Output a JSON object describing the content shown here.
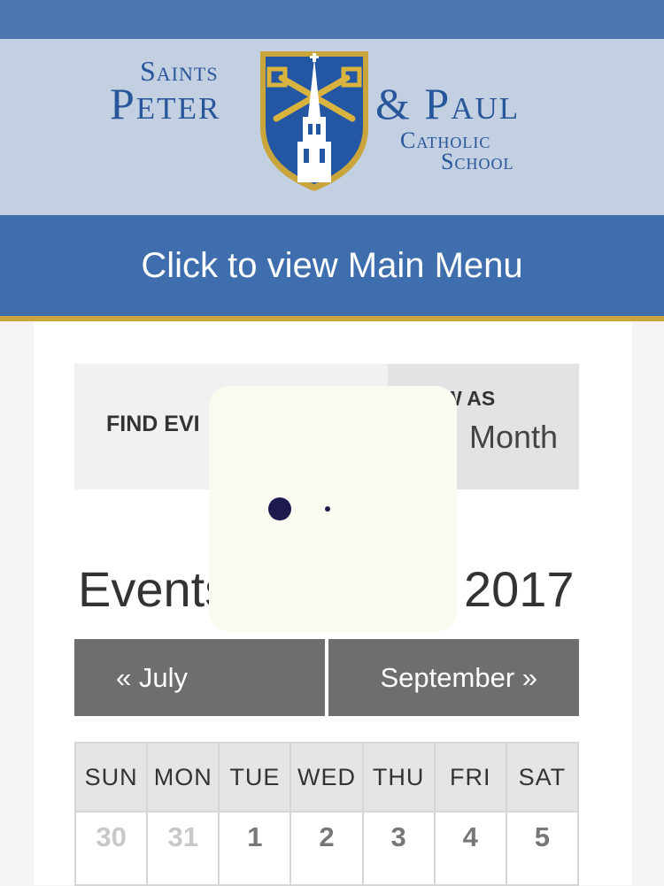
{
  "logo": {
    "line1": "Saints",
    "line2": "Peter",
    "line3": "& Paul",
    "line4": "Catholic",
    "line5": "School"
  },
  "menu": {
    "label": "Click to view Main Menu"
  },
  "filters": {
    "find_label": "FIND EVI",
    "view_as_label": "W AS",
    "view_as_value": "Month"
  },
  "events": {
    "title_visible": "Events",
    "year_visible": "2017"
  },
  "nav": {
    "prev_label": "« July",
    "next_label": "September »"
  },
  "calendar": {
    "weekdays": [
      "SUN",
      "MON",
      "TUE",
      "WED",
      "THU",
      "FRI",
      "SAT"
    ],
    "first_row": [
      "30",
      "31",
      "1",
      "2",
      "3",
      "4",
      "5"
    ]
  },
  "colors": {
    "topbar": "#4c78b0",
    "header_bg": "#c3d0e2",
    "menu_bg": "#3f6eae",
    "gold_accent": "#c9a53b",
    "nav_button": "#6e6e70",
    "loader_dot": "#1d1b4d"
  }
}
